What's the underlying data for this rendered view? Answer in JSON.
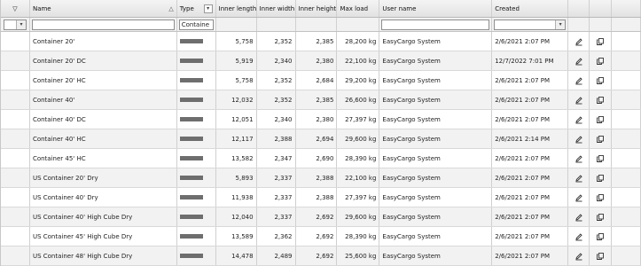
{
  "header": {
    "filter_icon": "▽",
    "name": "Name",
    "name_sort": "△",
    "type": "Type",
    "type_select": "▾",
    "inner_length": "Inner length",
    "inner_width": "Inner width",
    "inner_height": "Inner height",
    "max_load": "Max load",
    "user_name": "User name",
    "created": "Created"
  },
  "filters": {
    "type_value": "Containe",
    "arrow": "▾"
  },
  "rows": [
    {
      "name": "Container 20'",
      "length": "5,758",
      "width": "2,352",
      "height": "2,385",
      "load": "28,200 kg",
      "user": "EasyCargo System",
      "created": "2/6/2021 2:07 PM"
    },
    {
      "name": "Container 20' DC",
      "length": "5,919",
      "width": "2,340",
      "height": "2,380",
      "load": "22,100 kg",
      "user": "EasyCargo System",
      "created": "12/7/2022 7:01 PM"
    },
    {
      "name": "Container 20' HC",
      "length": "5,758",
      "width": "2,352",
      "height": "2,684",
      "load": "29,200 kg",
      "user": "EasyCargo System",
      "created": "2/6/2021 2:07 PM"
    },
    {
      "name": "Container 40'",
      "length": "12,032",
      "width": "2,352",
      "height": "2,385",
      "load": "26,600 kg",
      "user": "EasyCargo System",
      "created": "2/6/2021 2:07 PM"
    },
    {
      "name": "Container 40' DC",
      "length": "12,051",
      "width": "2,340",
      "height": "2,380",
      "load": "27,397 kg",
      "user": "EasyCargo System",
      "created": "2/6/2021 2:07 PM"
    },
    {
      "name": "Container 40' HC",
      "length": "12,117",
      "width": "2,388",
      "height": "2,694",
      "load": "29,600 kg",
      "user": "EasyCargo System",
      "created": "2/6/2021 2:14 PM"
    },
    {
      "name": "Container 45' HC",
      "length": "13,582",
      "width": "2,347",
      "height": "2,690",
      "load": "28,390 kg",
      "user": "EasyCargo System",
      "created": "2/6/2021 2:07 PM"
    },
    {
      "name": "US Container 20' Dry",
      "length": "5,893",
      "width": "2,337",
      "height": "2,388",
      "load": "22,100 kg",
      "user": "EasyCargo System",
      "created": "2/6/2021 2:07 PM"
    },
    {
      "name": "US Container 40' Dry",
      "length": "11,938",
      "width": "2,337",
      "height": "2,388",
      "load": "27,397 kg",
      "user": "EasyCargo System",
      "created": "2/6/2021 2:07 PM"
    },
    {
      "name": "US Container 40' High Cube Dry",
      "length": "12,040",
      "width": "2,337",
      "height": "2,692",
      "load": "29,600 kg",
      "user": "EasyCargo System",
      "created": "2/6/2021 2:07 PM"
    },
    {
      "name": "US Container 45' High Cube Dry",
      "length": "13,589",
      "width": "2,362",
      "height": "2,692",
      "load": "28,390 kg",
      "user": "EasyCargo System",
      "created": "2/6/2021 2:07 PM"
    },
    {
      "name": "US Container 48' High Cube Dry",
      "length": "14,478",
      "width": "2,489",
      "height": "2,692",
      "load": "25,600 kg",
      "user": "EasyCargo System",
      "created": "2/6/2021 2:07 PM"
    }
  ],
  "colors": {
    "type_bar": "#6e6e6e",
    "row_alt": "#f2f2f2",
    "header": "#e2e2e2"
  },
  "icons": {
    "edit": "pencil-icon",
    "copy": "copy-icon"
  }
}
